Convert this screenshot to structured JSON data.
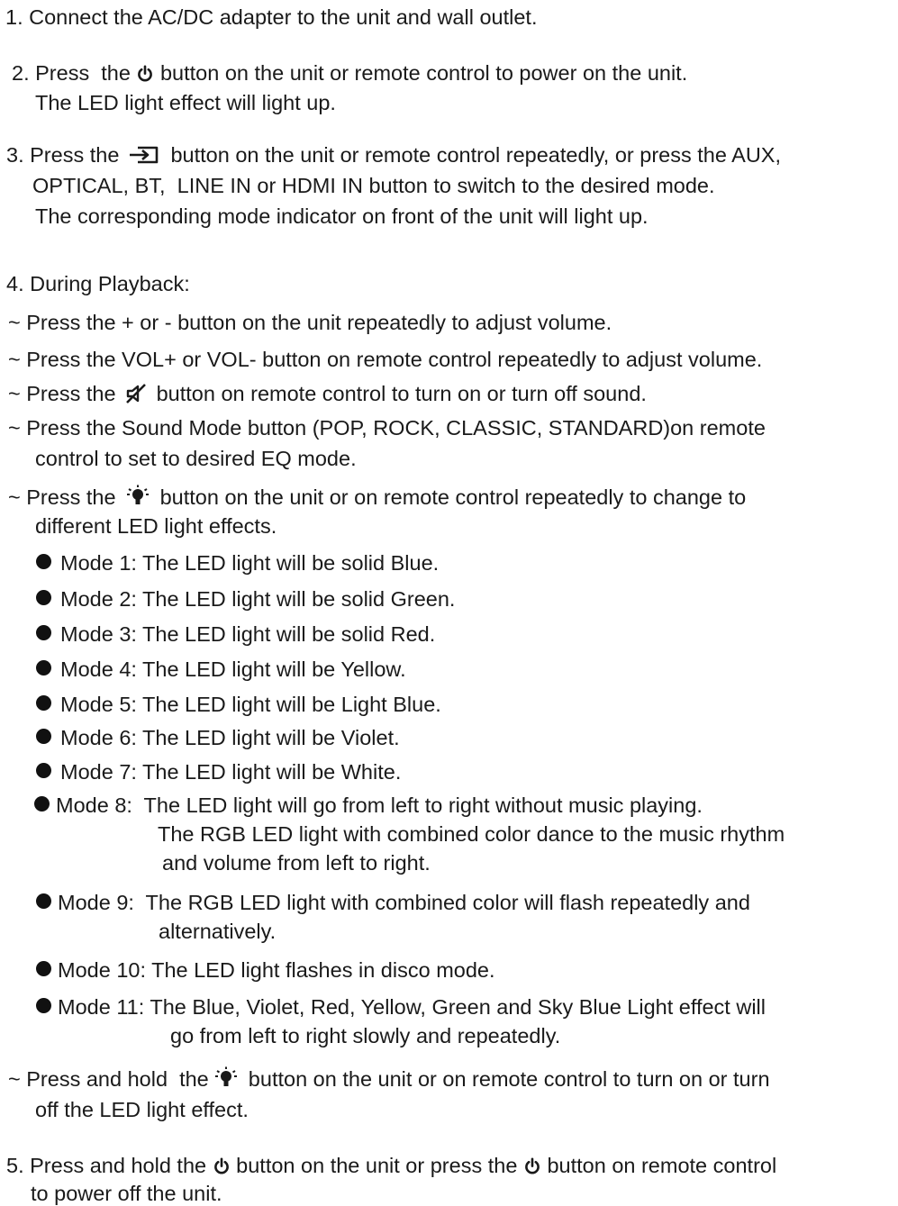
{
  "step1": {
    "text": "1. Connect the AC/DC adapter to the unit and wall outlet."
  },
  "step2": {
    "before_icon": "2. Press  the ",
    "icon": "power-icon",
    "after_icon": " button on the unit or remote control to power on the unit.",
    "line2": "The LED light effect will light up."
  },
  "step3": {
    "before_icon": "3. Press the ",
    "icon": "input-source-icon",
    "after_icon": " button on the unit or remote control repeatedly, or press the AUX,",
    "line2": "OPTICAL, BT,  LINE IN or HDMI IN button to switch to the desired mode.",
    "line3": "The corresponding mode indicator on front of the unit will light up."
  },
  "step4": {
    "heading": "4. During Playback:",
    "vol_unit": "~ Press the + or - button on the unit repeatedly to adjust volume.",
    "vol_remote": "~ Press the VOL+ or VOL- button on remote control repeatedly to adjust volume.",
    "mute_before": "~ Press the ",
    "mute_icon": "mute-icon",
    "mute_after": " button on remote control to turn on or turn off sound.",
    "sound_line1": "~ Press the Sound Mode button (POP, ROCK, CLASSIC, STANDARD)on remote",
    "sound_line2": "control to set to desired EQ mode.",
    "led_before": "~ Press the ",
    "led_icon": "light-bulb-icon",
    "led_after": " button on the unit or on remote control repeatedly to change to",
    "led_line2": "different LED light effects.",
    "modes": [
      {
        "label": "Mode 1: The LED light will be solid Blue."
      },
      {
        "label": "Mode 2: The LED light will be solid Green."
      },
      {
        "label": "Mode 3: The LED light will be solid Red."
      },
      {
        "label": "Mode 4: The LED light will be Yellow."
      },
      {
        "label": "Mode 5: The LED light will be Light Blue."
      },
      {
        "label": "Mode 6: The LED light will be Violet."
      },
      {
        "label": "Mode 7: The LED light will be White."
      },
      {
        "label": "Mode 8:  The LED light will go from left to right without music playing.",
        "line2": "The RGB LED light with combined color dance to the music rhythm",
        "line3": "and volume from left to right."
      },
      {
        "label": "Mode 9:  The RGB LED light with combined color will flash repeatedly and",
        "line2": "alternatively."
      },
      {
        "label": "Mode 10: The LED light flashes in disco mode."
      },
      {
        "label": "Mode 11: The Blue, Violet, Red, Yellow, Green and Sky Blue Light effect will",
        "line2": "go from left to right slowly and repeatedly."
      }
    ],
    "hold_before": "~ Press and hold  the ",
    "hold_icon": "light-bulb-icon",
    "hold_after": " button on the unit or on remote control to turn on or turn",
    "hold_line2": "off the LED light effect."
  },
  "step5": {
    "before_icon": "5. Press and hold the ",
    "icon": "power-icon",
    "middle": " button on the unit or press the ",
    "icon2": "power-icon",
    "after_icon": " button on remote control",
    "line2": "to power off the unit."
  }
}
